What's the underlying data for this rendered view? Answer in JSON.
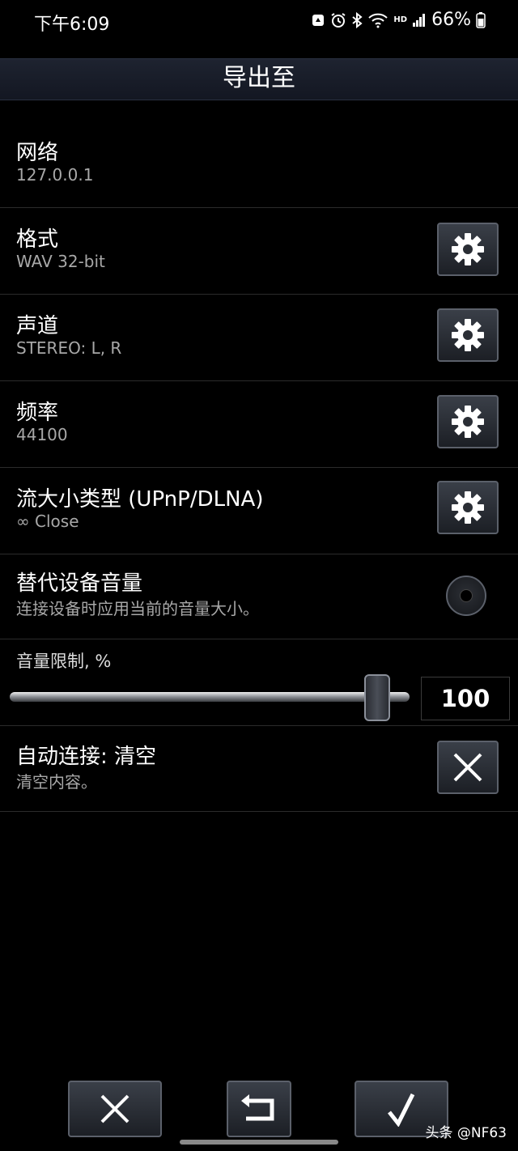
{
  "status": {
    "time": "下午6:09",
    "hd": "HD",
    "battery": "66%"
  },
  "header": {
    "title": "导出至"
  },
  "settings": [
    {
      "title": "网络",
      "subtitle": "127.0.0.1",
      "control": "none"
    },
    {
      "title": "格式",
      "subtitle": "WAV 32-bit",
      "control": "gear-icon"
    },
    {
      "title": "声道",
      "subtitle": "STEREO: L, R",
      "control": "gear-icon"
    },
    {
      "title": "频率",
      "subtitle": "44100",
      "control": "gear-icon"
    },
    {
      "title": "流大小类型 (UPnP/DLNA)",
      "subtitle": "∞ Close",
      "control": "gear-icon"
    },
    {
      "title": "替代设备音量",
      "subtitle": "连接设备时应用当前的音量大小。",
      "control": "radio",
      "checked": false
    },
    {
      "title": "自动连接: 清空",
      "subtitle": "清空内容。",
      "control": "close-icon"
    }
  ],
  "volume_limit": {
    "label": "音量限制, %",
    "value": "100",
    "fraction": 0.92
  },
  "footer": {
    "cancel_icon": "close-icon",
    "undo_icon": "undo-icon",
    "confirm_icon": "check-icon"
  },
  "watermark": "头条 @NF63",
  "colors": {
    "background": "#000000",
    "title_bar": "#1a1f2b",
    "subtitle": "#a8a8a8"
  }
}
